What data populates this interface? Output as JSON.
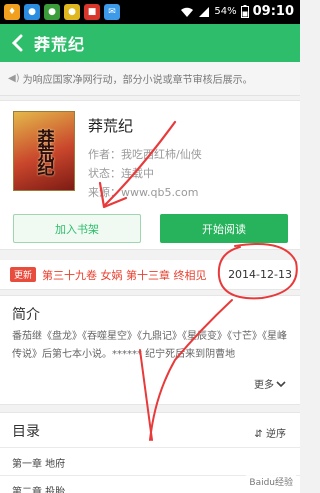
{
  "status_bar": {
    "battery": "54%",
    "time": "09:10",
    "colors": {
      "bg": "#000000"
    }
  },
  "header": {
    "title": "莽荒纪",
    "accent": "#2ebd6a"
  },
  "notice": {
    "text": "为响应国家净网行动，部分小说或章节审核后展示。"
  },
  "book": {
    "title": "莽荒纪",
    "cover_text": "莽荒纪",
    "author": "作者：我吃西红柿/仙侠",
    "status": "状态：连载中",
    "source": "来源：www.qb5.com",
    "add_shelf_label": "加入书架",
    "start_read_label": "开始阅读"
  },
  "update": {
    "badge": "更新",
    "chapter": "第三十九卷 女娲 第十三章 终相见",
    "date": "2014-12-13"
  },
  "intro": {
    "title": "简介",
    "text": "番茄继《盘龙》《吞噬星空》《九鼎记》《星辰变》《寸芒》《星峰传说》后第七本小说。****** 纪宁死后来到阴曹地",
    "more_label": "更多"
  },
  "toc": {
    "title": "目录",
    "order_label": "逆序",
    "items": [
      "第一章 地府",
      "第二章 投胎"
    ]
  },
  "watermark": "Baidu经验"
}
